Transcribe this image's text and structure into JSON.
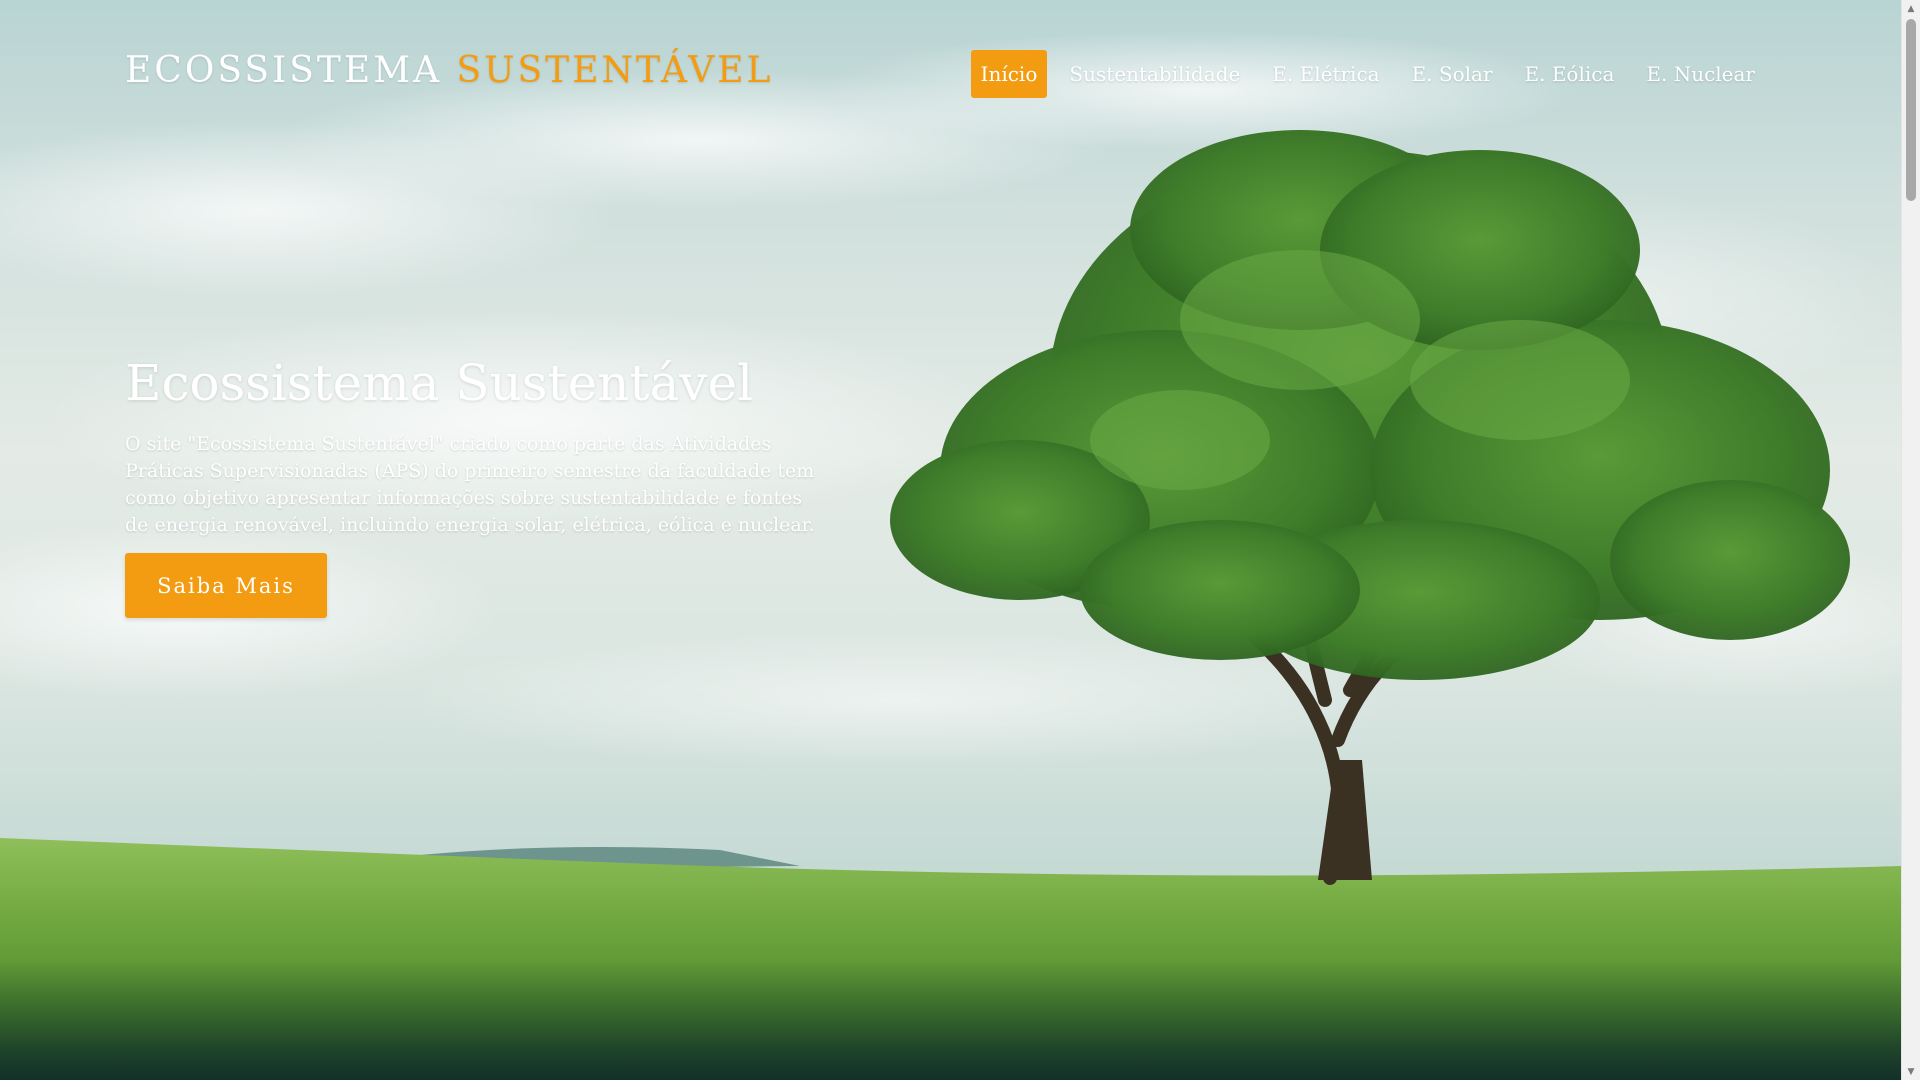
{
  "site": {
    "brand_main": "ECOSSISTEMA",
    "brand_accent": "SUSTENTÁVEL"
  },
  "nav": {
    "items": [
      {
        "label": "Início",
        "active": true
      },
      {
        "label": "Sustentabilidade",
        "active": false
      },
      {
        "label": "E. Elétrica",
        "active": false
      },
      {
        "label": "E. Solar",
        "active": false
      },
      {
        "label": "E. Eólica",
        "active": false
      },
      {
        "label": "E. Nuclear",
        "active": false
      }
    ]
  },
  "hero": {
    "title": "Ecossistema Sustentável",
    "description": "O site \"Ecossistema Sustentável\" criado como parte das Atividades Práticas Supervisionadas (APS) do primeiro semestre da faculdade tem como objetivo apresentar informações sobre sustentabilidade e fontes de energia renovável, incluindo energia solar, elétrica, eólica e nuclear.",
    "button_label": "Saiba Mais"
  },
  "colors": {
    "accent": "#f39c12",
    "text": "#ffffff"
  },
  "icons": {
    "scroll_up": "chevron-up-icon",
    "scroll_down": "chevron-down-icon"
  }
}
